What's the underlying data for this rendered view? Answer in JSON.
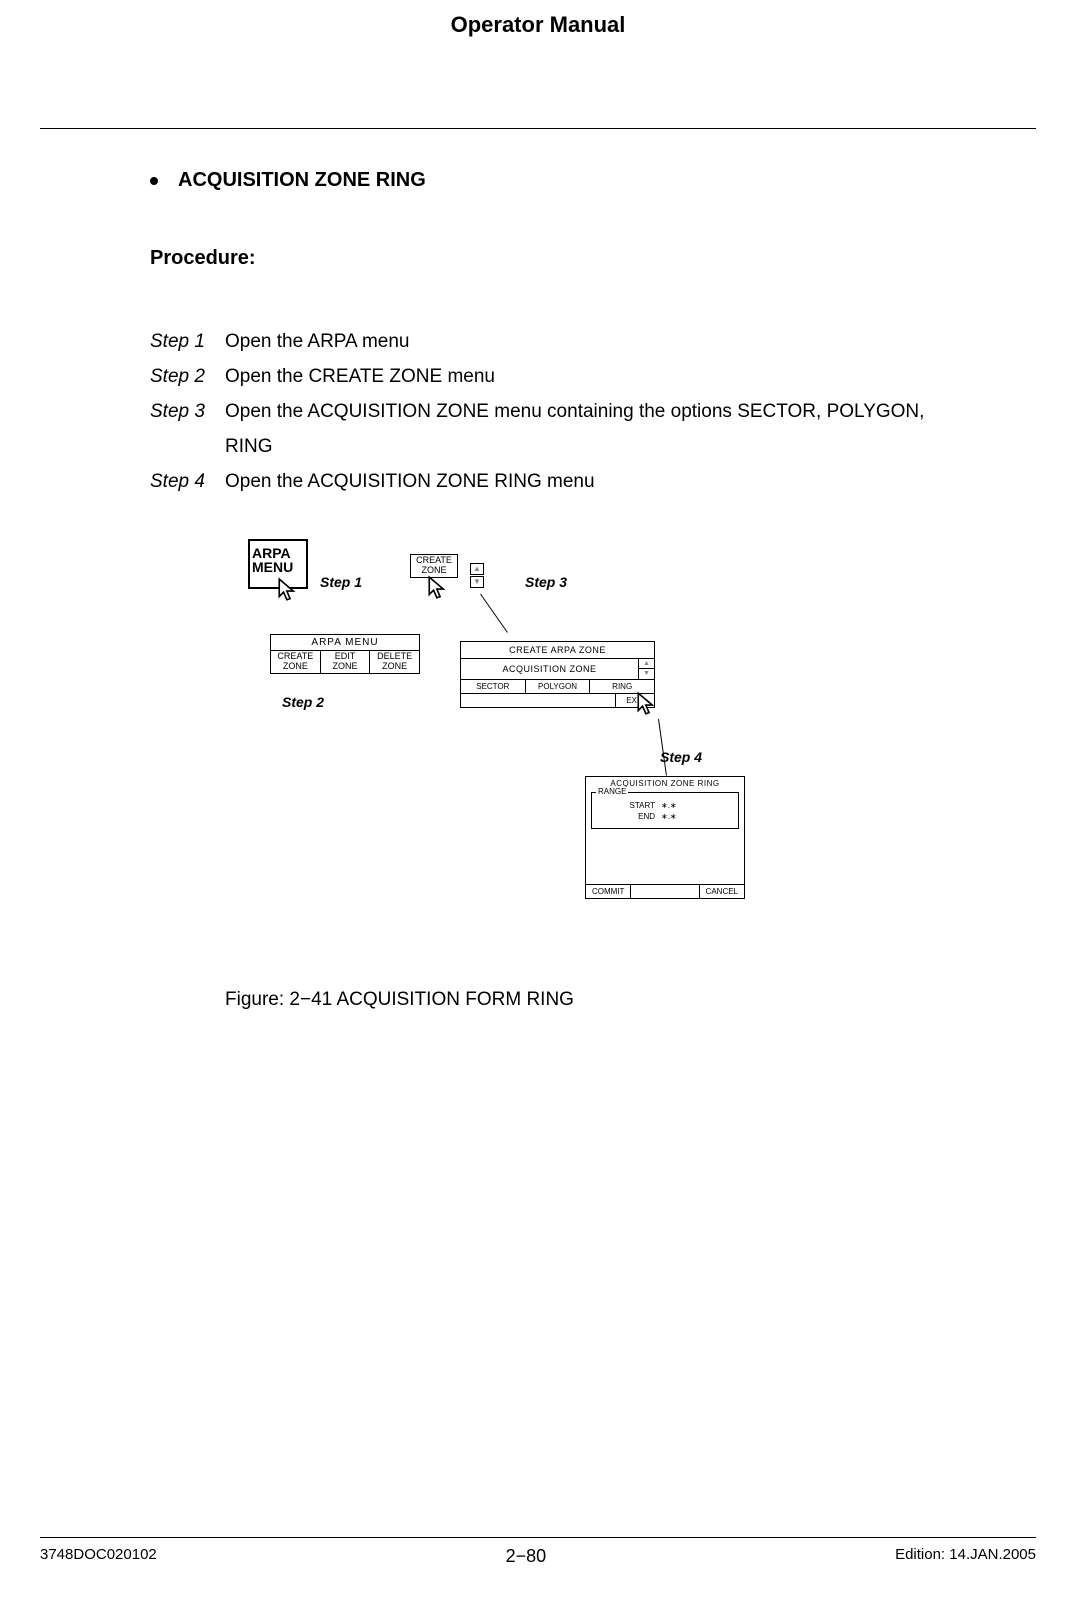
{
  "header": {
    "title": "Operator Manual"
  },
  "section": {
    "bullet_title": "ACQUISITION ZONE RING",
    "procedure_label": "Procedure:",
    "steps": [
      {
        "label": "Step 1",
        "text": "Open the ARPA menu"
      },
      {
        "label": "Step 2",
        "text": "Open the CREATE ZONE menu"
      },
      {
        "label": "Step 3",
        "text": "Open the ACQUISITION ZONE menu containing the options SECTOR, POLYGON, RING"
      },
      {
        "label": "Step 4",
        "text": "Open the ACQUISITION ZONE RING menu"
      }
    ]
  },
  "figure": {
    "caption": "Figure: 2−41 ACQUISITION FORM RING",
    "callouts": {
      "step1": "Step 1",
      "step2": "Step 2",
      "step3": "Step 3",
      "step4": "Step 4"
    },
    "arpa_menu_button": {
      "line1": "ARPA",
      "line2": "MENU"
    },
    "arpa_submenu": {
      "title": "ARPA  MENU",
      "items": [
        "CREATE ZONE",
        "EDIT ZONE",
        "DELETE ZONE"
      ]
    },
    "create_zone_button": "CREATE ZONE",
    "create_arpa_zone_menu": {
      "title": "CREATE ARPA ZONE",
      "subtitle": "ACQUISITION  ZONE",
      "options": [
        "SECTOR",
        "POLYGON",
        "RING"
      ],
      "exit": "EXIT"
    },
    "ring_menu": {
      "title": "ACQUISITION ZONE RING",
      "fieldset_label": "RANGE",
      "start_label": "START",
      "start_value": "∗.∗",
      "end_label": "END",
      "end_value": "∗.∗",
      "commit": "COMMIT",
      "cancel": "CANCEL"
    }
  },
  "footer": {
    "left": "3748DOC020102",
    "center": "2−80",
    "right": "Edition: 14.JAN.2005"
  }
}
